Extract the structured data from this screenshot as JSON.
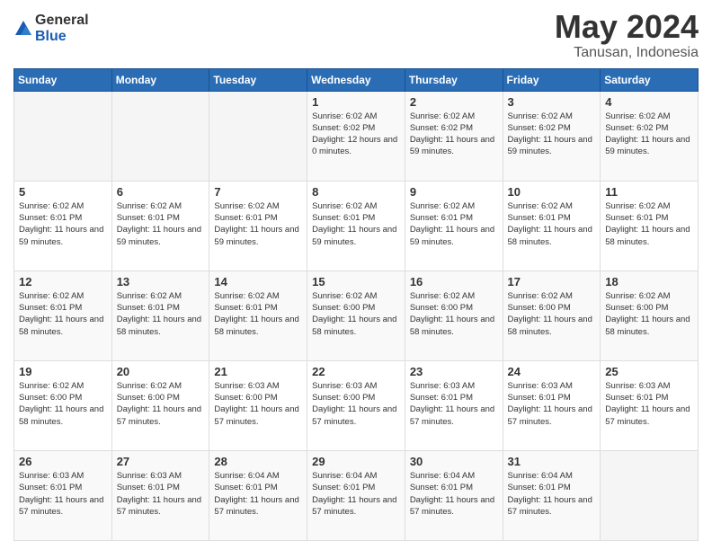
{
  "logo": {
    "general": "General",
    "blue": "Blue"
  },
  "title": "May 2024",
  "subtitle": "Tanusan, Indonesia",
  "weekdays": [
    "Sunday",
    "Monday",
    "Tuesday",
    "Wednesday",
    "Thursday",
    "Friday",
    "Saturday"
  ],
  "weeks": [
    [
      {
        "day": "",
        "info": ""
      },
      {
        "day": "",
        "info": ""
      },
      {
        "day": "",
        "info": ""
      },
      {
        "day": "1",
        "info": "Sunrise: 6:02 AM\nSunset: 6:02 PM\nDaylight: 12 hours and 0 minutes."
      },
      {
        "day": "2",
        "info": "Sunrise: 6:02 AM\nSunset: 6:02 PM\nDaylight: 11 hours and 59 minutes."
      },
      {
        "day": "3",
        "info": "Sunrise: 6:02 AM\nSunset: 6:02 PM\nDaylight: 11 hours and 59 minutes."
      },
      {
        "day": "4",
        "info": "Sunrise: 6:02 AM\nSunset: 6:02 PM\nDaylight: 11 hours and 59 minutes."
      }
    ],
    [
      {
        "day": "5",
        "info": "Sunrise: 6:02 AM\nSunset: 6:01 PM\nDaylight: 11 hours and 59 minutes."
      },
      {
        "day": "6",
        "info": "Sunrise: 6:02 AM\nSunset: 6:01 PM\nDaylight: 11 hours and 59 minutes."
      },
      {
        "day": "7",
        "info": "Sunrise: 6:02 AM\nSunset: 6:01 PM\nDaylight: 11 hours and 59 minutes."
      },
      {
        "day": "8",
        "info": "Sunrise: 6:02 AM\nSunset: 6:01 PM\nDaylight: 11 hours and 59 minutes."
      },
      {
        "day": "9",
        "info": "Sunrise: 6:02 AM\nSunset: 6:01 PM\nDaylight: 11 hours and 59 minutes."
      },
      {
        "day": "10",
        "info": "Sunrise: 6:02 AM\nSunset: 6:01 PM\nDaylight: 11 hours and 58 minutes."
      },
      {
        "day": "11",
        "info": "Sunrise: 6:02 AM\nSunset: 6:01 PM\nDaylight: 11 hours and 58 minutes."
      }
    ],
    [
      {
        "day": "12",
        "info": "Sunrise: 6:02 AM\nSunset: 6:01 PM\nDaylight: 11 hours and 58 minutes."
      },
      {
        "day": "13",
        "info": "Sunrise: 6:02 AM\nSunset: 6:01 PM\nDaylight: 11 hours and 58 minutes."
      },
      {
        "day": "14",
        "info": "Sunrise: 6:02 AM\nSunset: 6:01 PM\nDaylight: 11 hours and 58 minutes."
      },
      {
        "day": "15",
        "info": "Sunrise: 6:02 AM\nSunset: 6:00 PM\nDaylight: 11 hours and 58 minutes."
      },
      {
        "day": "16",
        "info": "Sunrise: 6:02 AM\nSunset: 6:00 PM\nDaylight: 11 hours and 58 minutes."
      },
      {
        "day": "17",
        "info": "Sunrise: 6:02 AM\nSunset: 6:00 PM\nDaylight: 11 hours and 58 minutes."
      },
      {
        "day": "18",
        "info": "Sunrise: 6:02 AM\nSunset: 6:00 PM\nDaylight: 11 hours and 58 minutes."
      }
    ],
    [
      {
        "day": "19",
        "info": "Sunrise: 6:02 AM\nSunset: 6:00 PM\nDaylight: 11 hours and 58 minutes."
      },
      {
        "day": "20",
        "info": "Sunrise: 6:02 AM\nSunset: 6:00 PM\nDaylight: 11 hours and 57 minutes."
      },
      {
        "day": "21",
        "info": "Sunrise: 6:03 AM\nSunset: 6:00 PM\nDaylight: 11 hours and 57 minutes."
      },
      {
        "day": "22",
        "info": "Sunrise: 6:03 AM\nSunset: 6:00 PM\nDaylight: 11 hours and 57 minutes."
      },
      {
        "day": "23",
        "info": "Sunrise: 6:03 AM\nSunset: 6:01 PM\nDaylight: 11 hours and 57 minutes."
      },
      {
        "day": "24",
        "info": "Sunrise: 6:03 AM\nSunset: 6:01 PM\nDaylight: 11 hours and 57 minutes."
      },
      {
        "day": "25",
        "info": "Sunrise: 6:03 AM\nSunset: 6:01 PM\nDaylight: 11 hours and 57 minutes."
      }
    ],
    [
      {
        "day": "26",
        "info": "Sunrise: 6:03 AM\nSunset: 6:01 PM\nDaylight: 11 hours and 57 minutes."
      },
      {
        "day": "27",
        "info": "Sunrise: 6:03 AM\nSunset: 6:01 PM\nDaylight: 11 hours and 57 minutes."
      },
      {
        "day": "28",
        "info": "Sunrise: 6:04 AM\nSunset: 6:01 PM\nDaylight: 11 hours and 57 minutes."
      },
      {
        "day": "29",
        "info": "Sunrise: 6:04 AM\nSunset: 6:01 PM\nDaylight: 11 hours and 57 minutes."
      },
      {
        "day": "30",
        "info": "Sunrise: 6:04 AM\nSunset: 6:01 PM\nDaylight: 11 hours and 57 minutes."
      },
      {
        "day": "31",
        "info": "Sunrise: 6:04 AM\nSunset: 6:01 PM\nDaylight: 11 hours and 57 minutes."
      },
      {
        "day": "",
        "info": ""
      }
    ]
  ]
}
